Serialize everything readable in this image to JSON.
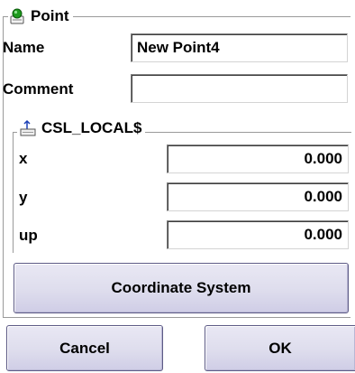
{
  "point_group": {
    "title": "Point",
    "icon": "point-icon",
    "name_label": "Name",
    "name_value": "New Point4",
    "comment_label": "Comment",
    "comment_value": ""
  },
  "coord_group": {
    "title": "CSL_LOCAL$",
    "icon": "coordinate-system-icon",
    "x_label": "x",
    "x_value": "0.000",
    "y_label": "y",
    "y_value": "0.000",
    "up_label": "up",
    "up_value": "0.000"
  },
  "buttons": {
    "coordinate_system": "Coordinate System",
    "cancel": "Cancel",
    "ok": "OK"
  },
  "colors": {
    "button_border": "#5d5b86",
    "button_fill": "#dedded",
    "frame_line": "#9a9a9a"
  }
}
